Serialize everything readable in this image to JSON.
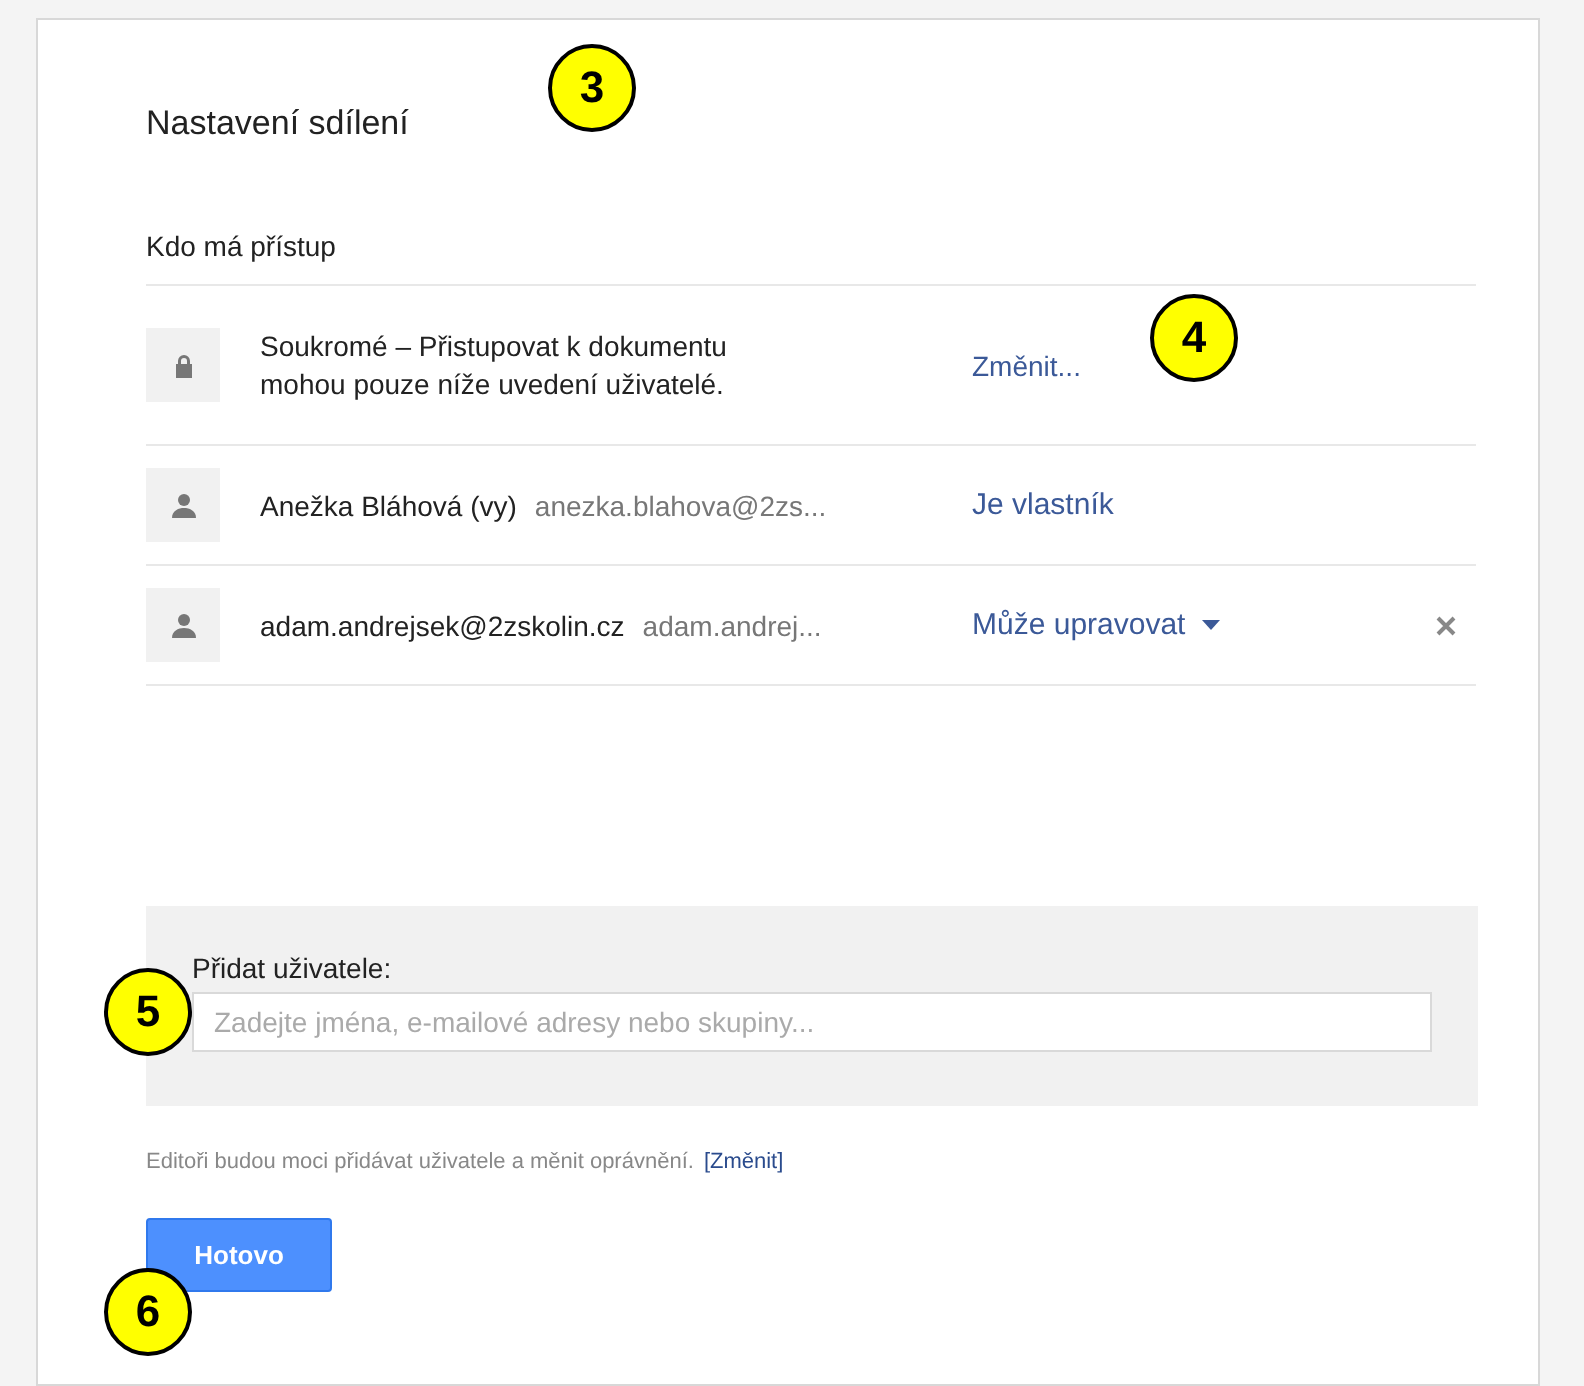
{
  "dialog": {
    "title": "Nastavení sdílení",
    "section_title": "Kdo má přístup"
  },
  "rows": [
    {
      "kind": "visibility",
      "text": "Soukromé – Přistupovat k dokumentu mohou pouze níže uvedení uživatelé.",
      "action": "Změnit..."
    },
    {
      "kind": "user",
      "name": "Anežka Bláhová (vy)",
      "email": "anezka.blahova@2zs...",
      "role": "Je vlastník",
      "menu": false,
      "removable": false
    },
    {
      "kind": "user",
      "name": "adam.andrejsek@2zskolin.cz",
      "email": "adam.andrej...",
      "role": "Může upravovat",
      "menu": true,
      "removable": true
    }
  ],
  "add_users": {
    "label": "Přidat uživatele:",
    "placeholder": "Zadejte jména, e-mailové adresy nebo skupiny..."
  },
  "note": {
    "text": "Editoři budou moci přidávat uživatele a měnit oprávnění.",
    "link": "[Změnit]"
  },
  "done_button": "Hotovo",
  "callouts": [
    {
      "label": "3"
    },
    {
      "label": "4"
    },
    {
      "label": "5"
    },
    {
      "label": "6"
    }
  ]
}
